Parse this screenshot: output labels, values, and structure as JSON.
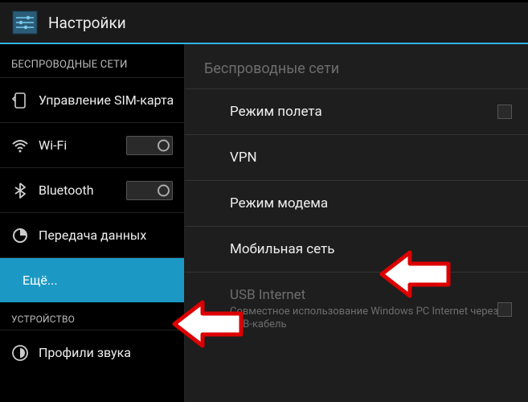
{
  "header": {
    "title": "Настройки"
  },
  "sidebar": {
    "section_wireless": "БЕСПРОВОДНЫЕ СЕТИ",
    "section_device": "УСТРОЙСТВО",
    "sim": "Управление SIM-картами",
    "wifi": "Wi-Fi",
    "bluetooth": "Bluetooth",
    "data": "Передача данных",
    "more": "Ещё...",
    "profiles": "Профили звука"
  },
  "main": {
    "header": "Беспроводные сети",
    "airplane": "Режим полета",
    "vpn": "VPN",
    "tether": "Режим модема",
    "mobile": "Мобильная сеть",
    "usb_title": "USB Internet",
    "usb_sub": "Совместное использование Windows PC Internet через USB-кабель"
  }
}
